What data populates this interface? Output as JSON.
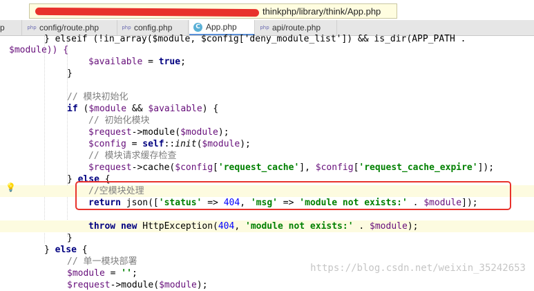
{
  "tooltip": {
    "path": "thinkphp/library/think/App.php"
  },
  "tabs": [
    {
      "label": "p",
      "icon": ""
    },
    {
      "label": "config/route.php",
      "icon": "php"
    },
    {
      "label": "config.php",
      "icon": "php"
    },
    {
      "label": "App.php",
      "icon": "C"
    },
    {
      "label": "api/route.php",
      "icon": "php"
    }
  ],
  "code": {
    "l0": [
      "} elseif (!in_array($module, $config['deny_module_list']) && is_dir(APP_PATH ."
    ],
    "l1": "$module)) {",
    "l2": [
      "$available",
      " = ",
      "true",
      ";"
    ],
    "l4": "// 模块初始化",
    "l5": [
      "if",
      " (",
      "$module",
      " && ",
      "$available",
      ") {"
    ],
    "l6": "// 初始化模块",
    "l7": [
      "$request",
      "->module(",
      "$module",
      ");"
    ],
    "l8": [
      "$config",
      " = ",
      "self",
      "::",
      "init",
      "(",
      "$module",
      ");"
    ],
    "l9": "// 模块请求缓存检查",
    "l10": [
      "$request",
      "->cache(",
      "$config",
      "[",
      "'request_cache'",
      "], ",
      "$config",
      "[",
      "'request_cache_expire'",
      "]);"
    ],
    "l11": [
      "} ",
      "else",
      " {"
    ],
    "l12": "//空模块处理",
    "l13": [
      "return",
      " json([",
      "'status'",
      " => ",
      "404",
      ", ",
      "'msg'",
      " => ",
      "'module not exists:'",
      " . ",
      "$module",
      "]);"
    ],
    "l15": [
      "throw",
      " ",
      "new",
      " HttpException(",
      "404",
      ", ",
      "'module not exists:'",
      " . ",
      "$module",
      ");"
    ],
    "l16": "}",
    "l17": [
      "} ",
      "else",
      " {"
    ],
    "l18": "// 单一模块部署",
    "l19": [
      "$module",
      " = ",
      "''",
      ";"
    ],
    "l20": [
      "$request",
      "->module(",
      "$module",
      ");"
    ]
  },
  "watermark": "https://blog.csdn.net/weixin_35242653",
  "colors": {
    "keyword": "#000080",
    "variable": "#660e7a",
    "string": "#008000",
    "number": "#0000ff",
    "comment": "#808080",
    "highlight_box": "#e8322c",
    "tooltip_bg": "#fffde0"
  }
}
